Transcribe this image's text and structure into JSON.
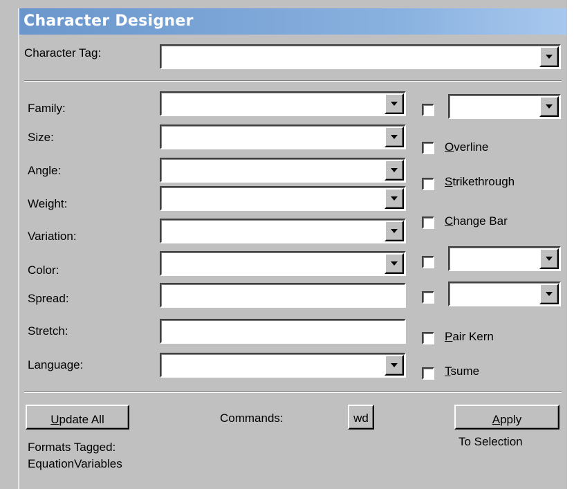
{
  "window": {
    "title": "Character Designer"
  },
  "character_tag": {
    "label": "Character Tag:",
    "value": ""
  },
  "labels": {
    "family": "Family:",
    "size": "Size:",
    "angle": "Angle:",
    "weight": "Weight:",
    "variation": "Variation:",
    "color": "Color:",
    "spread": "Spread:",
    "stretch": "Stretch:",
    "language": "Language:"
  },
  "values": {
    "family": "",
    "size": "",
    "angle": "",
    "weight": "",
    "variation": "",
    "color": "",
    "spread": "",
    "stretch": "",
    "language": ""
  },
  "right": {
    "overline_u": "O",
    "overline_rest": "verline",
    "strikethrough_u": "S",
    "strikethrough_rest": "trikethrough",
    "changebar_u": "C",
    "changebar_rest": "hange Bar",
    "pairkern_u": "P",
    "pairkern_rest": "air Kern",
    "tsume_u": "T",
    "tsume_rest": "sume",
    "underline_style_value": "",
    "position_value": "",
    "case_value": ""
  },
  "bottom": {
    "update_u": "U",
    "update_rest": "pdate All",
    "commands_label": "Commands:",
    "commands_button": "wd",
    "apply_u": "A",
    "apply_rest": "pply",
    "apply_target": "To Selection",
    "formats_tagged_label": "Formats Tagged:",
    "formats_tagged_value": "EquationVariables"
  }
}
